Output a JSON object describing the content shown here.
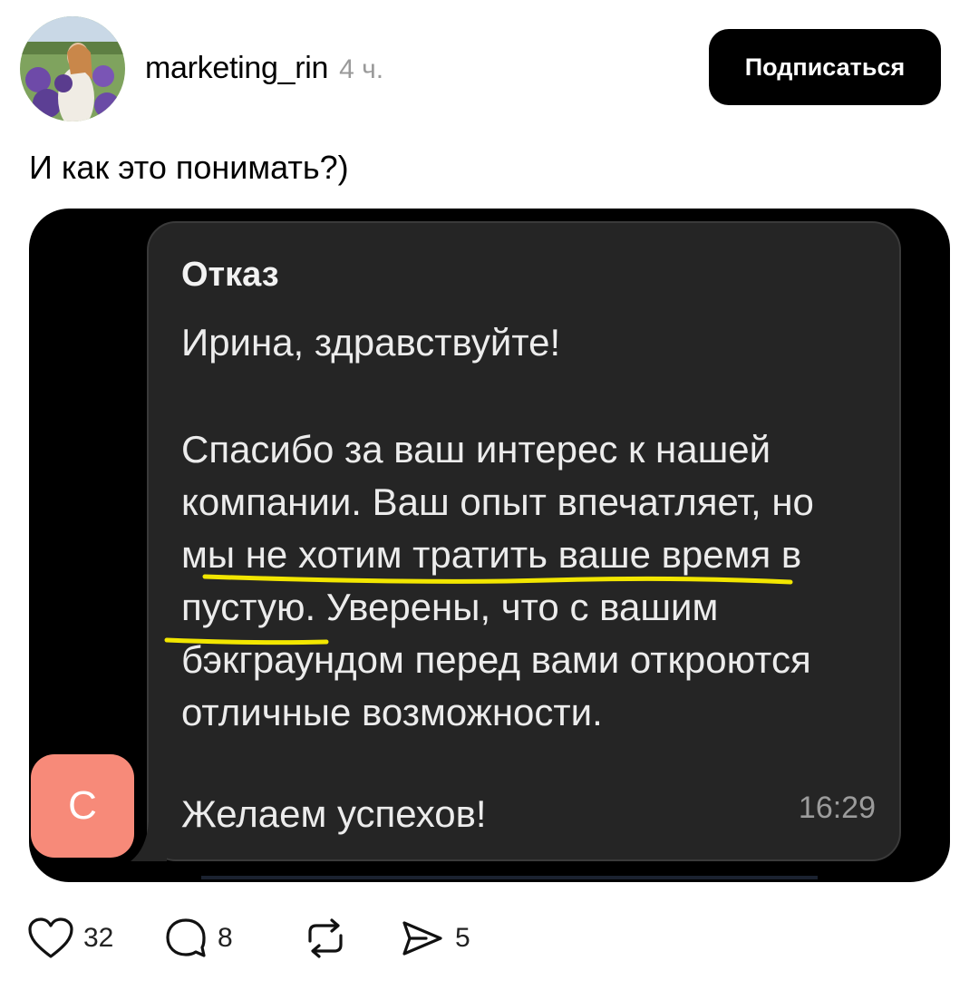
{
  "post": {
    "author": "marketing_rin",
    "time": "4 ч.",
    "follow_label": "Подписаться",
    "caption": "И как это понимать?)"
  },
  "message": {
    "title": "Отказ",
    "greeting": "Ирина, здравствуйте!",
    "body_lines": [
      "Спасибо за ваш интерес к нашей",
      "компании. Ваш опыт впечатляет, но",
      "мы не хотим тратить ваше время в",
      "пустую. Уверены, что с вашим",
      "бэкграундом перед вами откроются",
      "отличные возможности."
    ],
    "closing": "Желаем успехов!",
    "time": "16:29",
    "sender_initial": "С",
    "underline_color": "#f2e600",
    "avatar_color": "#f78a79"
  },
  "actions": {
    "likes": "32",
    "comments": "8",
    "shares": "5",
    "icons": [
      "heart-icon",
      "comment-icon",
      "repost-icon",
      "send-icon"
    ]
  }
}
